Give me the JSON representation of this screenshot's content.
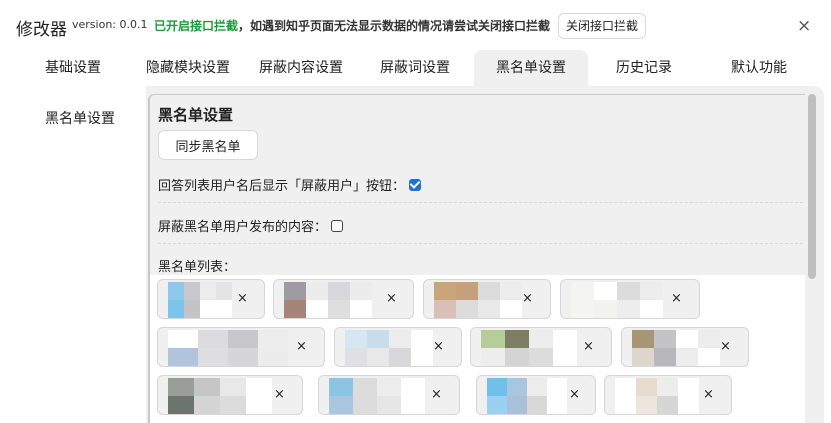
{
  "header": {
    "title": "修改器",
    "version": "version: 0.0.1",
    "notice_green": "已开启接口拦截",
    "notice_rest": "，如遇到知乎页面无法显示数据的情况请尝试关闭接口拦截",
    "toggle_intercept_label": "关闭接口拦截",
    "close_symbol": "×"
  },
  "tabs": [
    {
      "label": "基础设置"
    },
    {
      "label": "隐藏模块设置"
    },
    {
      "label": "屏蔽内容设置"
    },
    {
      "label": "屏蔽词设置"
    },
    {
      "label": "黑名单设置",
      "active": true
    },
    {
      "label": "历史记录"
    },
    {
      "label": "默认功能"
    }
  ],
  "sidebar": {
    "items": [
      {
        "label": "黑名单设置"
      }
    ]
  },
  "blacklist": {
    "title": "黑名单设置",
    "sync_label": "同步黑名单",
    "option_show_block_button": {
      "label": "回答列表用户名后显示「屏蔽用户」按钮：",
      "checked": true
    },
    "option_block_content": {
      "label": "屏蔽黑名单用户发布的内容：",
      "checked": false
    },
    "list_label": "黑名单列表：",
    "remove_symbol": "×",
    "users": [
      {
        "colors": [
          "#8ec8ea",
          "#c9c9cd",
          "#ededed",
          "#e4e4e8",
          "#7cc4ea",
          "#c4c4c8",
          "#ffffff",
          "#ffffff"
        ]
      },
      {
        "colors": [
          "#9f9ba3",
          "#ececec",
          "#d8d8dc",
          "#ececec",
          "#a68478",
          "#ffffff",
          "#dedede",
          "#ffffff"
        ]
      },
      {
        "colors": [
          "#c9a57a",
          "#c6a07a",
          "#dcdcdc",
          "#ededed",
          "#d8c0b6",
          "#dcdcdc",
          "#e8e8e8",
          "#ffffff"
        ]
      },
      {
        "colors": [
          "#f4f4f4",
          "#ffffff",
          "#dcdcdc",
          "#ededed",
          "#f4f4f0",
          "#f2f2ee",
          "#ededed",
          "#ffffff"
        ]
      },
      {
        "colors": [
          "#ffffff",
          "#dcdcde",
          "#c8c8cc",
          "#ededed",
          "#b0c4dc",
          "#dedee2",
          "#d6d6da",
          "#ececec"
        ]
      },
      {
        "colors": [
          "#d6e6f2",
          "#c8dcec",
          "#ededed",
          "#ffffff",
          "#e0e0e4",
          "#e8e8e8",
          "#d8d8dc",
          "#ffffff"
        ]
      },
      {
        "colors": [
          "#b8cc9a",
          "#7e7e64",
          "#ededed",
          "#ffffff",
          "#ededed",
          "#d4d4d4",
          "#dcdcdc",
          "#ffffff"
        ]
      },
      {
        "colors": [
          "#a89676",
          "#c4c4c8",
          "#ffffff",
          "#ededed",
          "#dcd6cc",
          "#b8b8bc",
          "#ededed",
          "#ffffff"
        ]
      },
      {
        "colors": [
          "#9a9e9a",
          "#c6c6c6",
          "#e8e8e8",
          "#ffffff",
          "#6c7470",
          "#d4d4d4",
          "#dcdcdc",
          "#ffffff"
        ]
      },
      {
        "colors": [
          "#8cc4e6",
          "#dcdcdc",
          "#ededed",
          "#ffffff",
          "#a8c6e0",
          "#dcdcdc",
          "#e6e6e6",
          "#ffffff"
        ]
      },
      {
        "colors": [
          "#70c0ec",
          "#a8c6e0",
          "#ededed",
          "#ffffff",
          "#9cd0f0",
          "#a8c0d8",
          "#d8d8d8",
          "#ffffff"
        ]
      },
      {
        "colors": [
          "#ffffff",
          "#e6dcd0",
          "#ededed",
          "#ffffff",
          "#ffffff",
          "#ece6dc",
          "#d6d6d6",
          "#ffffff"
        ]
      }
    ]
  }
}
